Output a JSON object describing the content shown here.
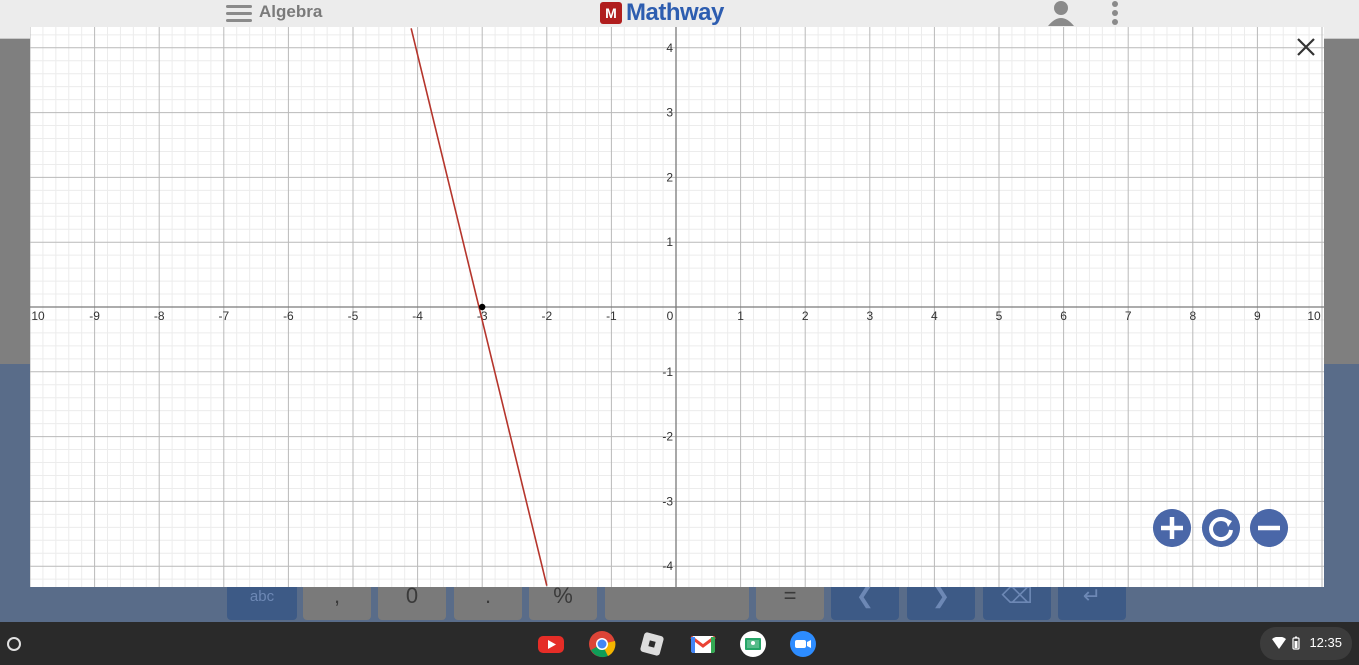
{
  "header": {
    "subject": "Algebra",
    "logo_badge": "M",
    "logo_text": "Mathway"
  },
  "keypad": {
    "keys": [
      "abc",
      ",",
      "0",
      ".",
      "%",
      "",
      "=",
      "",
      "",
      "",
      ""
    ]
  },
  "graph": {
    "x_ticks": [
      "10",
      "-9",
      "-8",
      "-7",
      "-6",
      "-5",
      "-4",
      "-3",
      "-2",
      "-1",
      "0",
      "1",
      "2",
      "3",
      "4",
      "5",
      "6",
      "7",
      "8",
      "9",
      "10"
    ],
    "y_ticks": [
      "4",
      "3",
      "2",
      "1",
      "-1",
      "-2",
      "-3",
      "-4"
    ],
    "line_color": "#b5352c",
    "point_color": "#000000"
  },
  "chart_data": {
    "type": "line",
    "xlim": [
      -10,
      10
    ],
    "ylim": [
      -4.3,
      4.3
    ],
    "grid": true,
    "series": [
      {
        "x": [
          -4.1,
          -2.0
        ],
        "y": [
          4.3,
          -4.3
        ]
      }
    ],
    "points": [
      {
        "x": -3,
        "y": 0
      }
    ]
  },
  "controls": {
    "zoom_in": "zoom-in",
    "reset": "reset",
    "zoom_out": "zoom-out"
  },
  "taskbar": {
    "clock": "12:35"
  }
}
